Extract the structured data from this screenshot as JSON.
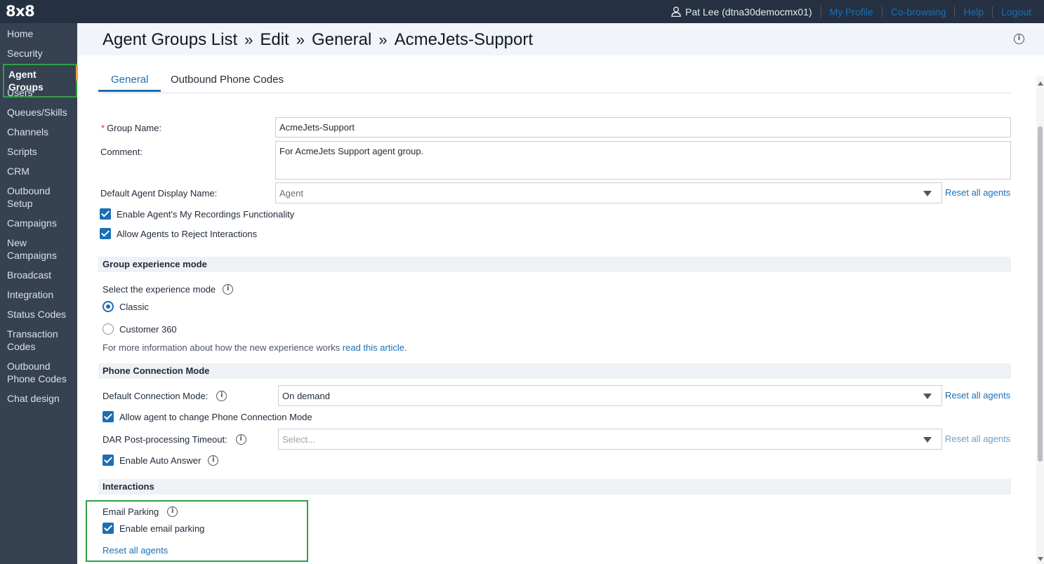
{
  "topbar": {
    "logo": "8x8",
    "user": "Pat Lee (dtna30democmx01)",
    "links": [
      "My Profile",
      "Co-browsing",
      "Help",
      "Logout"
    ]
  },
  "sidebar": {
    "items": [
      "Home",
      "Security",
      "Agent Groups",
      "Users",
      "Queues/Skills",
      "Channels",
      "Scripts",
      "CRM",
      "Outbound Setup",
      "Campaigns",
      "New Campaigns",
      "Broadcast",
      "Integration",
      "Status Codes",
      "Transaction Codes",
      "Outbound Phone Codes",
      "Chat design"
    ],
    "item_lines": [
      [
        "Outbound",
        "Setup"
      ],
      [
        "New",
        "Campaigns"
      ],
      [
        "Transaction",
        "Codes"
      ],
      [
        "Outbound",
        "Phone Codes"
      ]
    ],
    "active": "Agent Groups"
  },
  "header": {
    "crumbs": [
      "Agent Groups List",
      "Edit",
      "General",
      "AcmeJets-Support"
    ],
    "separator": "»"
  },
  "tabs": [
    "General",
    "Outbound Phone Codes"
  ],
  "form": {
    "group_name_label": "Group Name:",
    "group_name_value": "AcmeJets-Support",
    "comment_label": "Comment:",
    "comment_value": "For AcmeJets Support agent group.",
    "display_name_label": "Default Agent Display Name:",
    "display_name_value": "Agent",
    "reset_all": "Reset all agents",
    "enable_recordings": "Enable Agent's My Recordings Functionality",
    "allow_reject": "Allow Agents to Reject Interactions"
  },
  "experience": {
    "section": "Group experience mode",
    "select_label": "Select the experience mode",
    "options": [
      "Classic",
      "Customer 360"
    ],
    "selected": "Classic",
    "info_text": "For more information about how the new experience works",
    "info_link": "read this article."
  },
  "phone": {
    "section": "Phone Connection Mode",
    "default_label": "Default Connection Mode:",
    "default_value": "On demand",
    "allow_change": "Allow agent to change Phone Connection Mode",
    "dar_label": "DAR Post-processing Timeout:",
    "dar_placeholder": "Select...",
    "auto_answer": "Enable Auto Answer"
  },
  "interactions": {
    "section": "Interactions",
    "email_parking_label": "Email Parking",
    "enable_email_parking": "Enable email parking",
    "reset_all": "Reset all agents"
  },
  "colors": {
    "accent": "#1a6fb5",
    "topbar": "#253142",
    "sidebar": "#364152",
    "highlight": "#2ea043"
  }
}
